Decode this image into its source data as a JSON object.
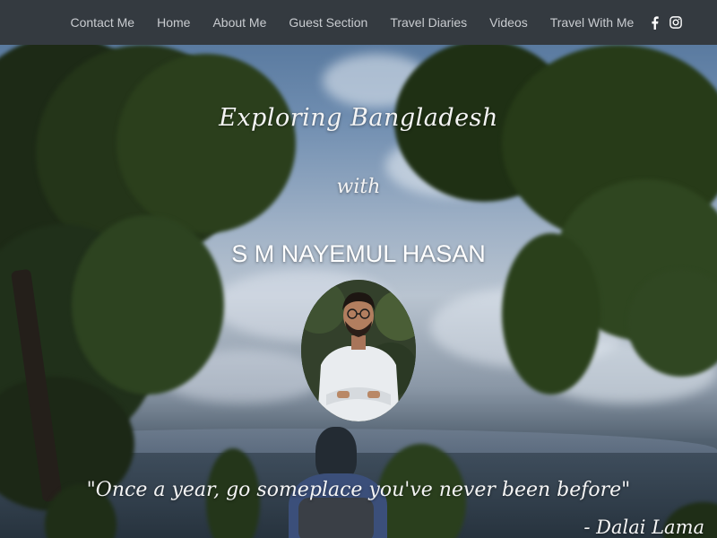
{
  "nav": {
    "links": [
      "Contact Me",
      "Home",
      "About Me",
      "Guest Section",
      "Travel Diaries",
      "Videos",
      "Travel With Me"
    ],
    "social": [
      "facebook-icon",
      "instagram-icon"
    ]
  },
  "hero": {
    "title_line1": "Exploring Bangladesh",
    "title_line2": "with",
    "name": "S M NAYEMUL HASAN",
    "quote": "\"Once a year, go someplace you've never been before\"",
    "quote_author": "- Dalai Lama"
  },
  "colors": {
    "navbar_bg": "#343a40",
    "nav_text": "#c9ccd0",
    "hero_text": "#f4f4f4"
  }
}
